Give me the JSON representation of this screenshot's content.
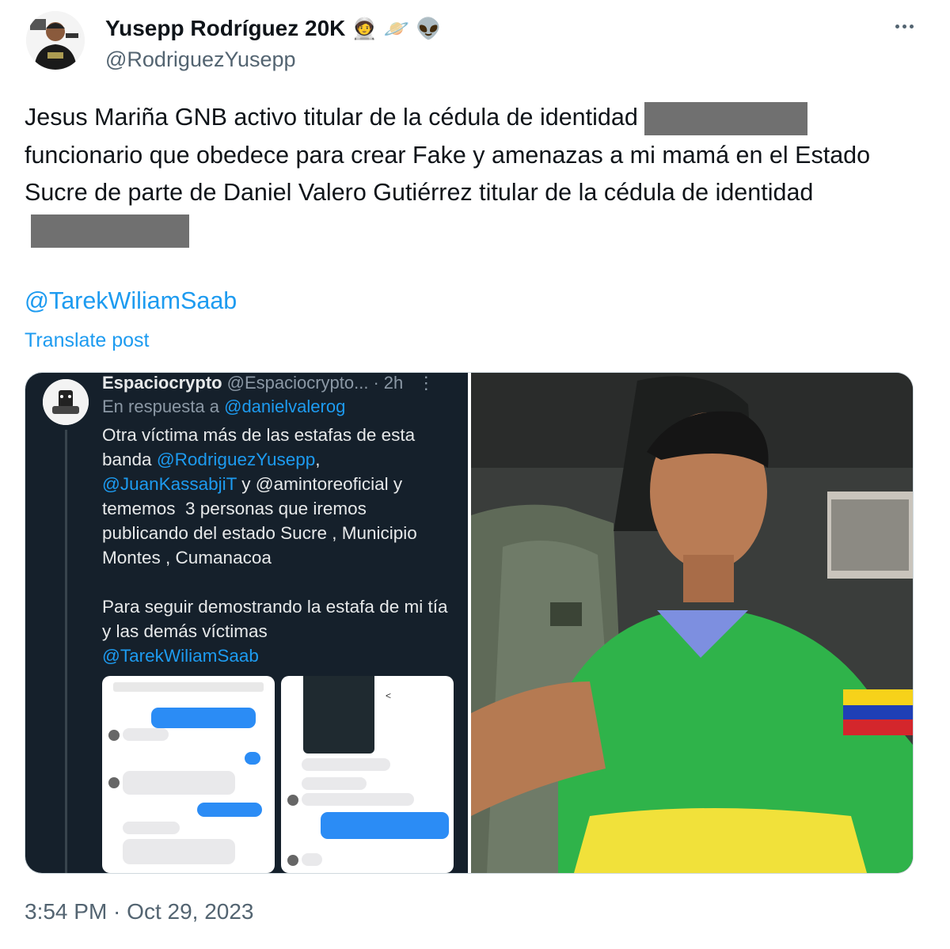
{
  "author": {
    "display_name": "Yusepp Rodríguez 20K",
    "emojis": [
      "🧑‍🚀",
      "🪐",
      "👽"
    ],
    "handle": "@RodriguezYusepp"
  },
  "tweet": {
    "text_part1": "Jesus Mariña GNB activo titular de la cédula de identidad",
    "text_part2": "funcionario que obedece para crear Fake y amenazas a mi mamá en el Estado Sucre de parte de Daniel Valero Gutiérrez titular de la cédula de identidad",
    "mention": "@TarekWiliamSaab",
    "translate_label": "Translate post",
    "timestamp": "3:54 PM · Oct 29, 2023"
  },
  "embedded_post": {
    "name": "Espaciocrypto",
    "handle": "@Espaciocrypto...",
    "sep": "·",
    "time": "2h",
    "reply_prefix": "En respuesta a",
    "reply_to": "@danielvalerog",
    "line1": "Otra víctima más de las estafas de esta banda ",
    "mention1": "@RodriguezYusepp",
    "comma": ",",
    "mention2": "@JuanKassabjiT",
    "line2": " y @amintoreoficial y tememos  3 personas que iremos publicando del estado Sucre , Municipio Montes , Cumanacoa\n\nPara seguir demostrando la estafa de mi tía y las demás víctimas\n",
    "mention3": "@TarekWiliamSaab"
  },
  "colors": {
    "link": "#1d9bf0",
    "text": "#0f1419",
    "muted": "#536471",
    "dark_bg": "#15202b"
  }
}
